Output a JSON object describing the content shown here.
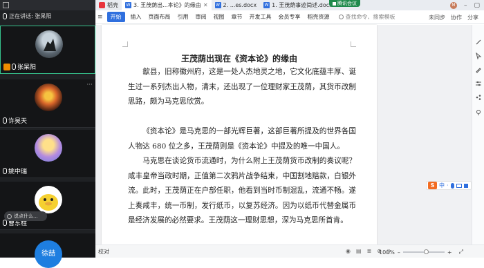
{
  "meeting": {
    "app_icon": "grid-icon",
    "speaking_label": "正在讲话: 张杲阳",
    "participants": [
      {
        "name": "张杲阳",
        "active": true
      },
      {
        "name": "许昊天",
        "active": false
      },
      {
        "name": "姚中瑞",
        "active": false
      },
      {
        "name": "曹东柱",
        "active": false
      },
      {
        "name": "徐喆",
        "active": false
      }
    ],
    "say_something": "说点什么..."
  },
  "browser": {
    "app_name": "稻壳",
    "tabs": [
      {
        "label": "3. 王茂荫出...本论》的缘由",
        "active": true
      },
      {
        "label": "2. ...es.docx",
        "active": false
      },
      {
        "label": "1. 王茂荫事迹简述.docx",
        "active": false
      }
    ],
    "share_badge": "腾讯会议",
    "avatar_letter": "M"
  },
  "ribbon": {
    "tabs": [
      "开始",
      "插入",
      "页面布局",
      "引用",
      "审阅",
      "视图",
      "章节",
      "开发工具",
      "会员专享",
      "稻壳资源"
    ],
    "search_placeholder": "查找命令、搜索模板",
    "right_items": [
      "未同步",
      "协作",
      "分享"
    ]
  },
  "document": {
    "title": "王茂荫出现在《资本论》的缘由",
    "paragraphs": [
      "歙县，旧称徽州府，这是一处人杰地灵之地，它文化底蕴丰厚、诞生过一系列杰出人物，清末，还出现了一位理财家王茂荫，其货币改制思路，颇为马克思欣赏。",
      "《资本论》是马克思的一部光辉巨著，这部巨著所提及的世界各国人物达 680 位之多，王茂荫则是《资本论》中提及的唯一中国人。",
      "马克思在谈论货币流通时，为什么附上王茂荫货币改制的奏议呢？咸丰皇帝当政时期，正值第二次鸦片战争结束，中国割地赔款，白银外流。此时，王茂荫正在户部任职，他看到当时币制混乱，流通不畅。遂上奏咸丰，统一币制，发行纸币，以复苏经济。因为以纸币代替金属币是经济发展的必然要求。王茂荫这一理财思想，深为马克思所首肯。"
    ]
  },
  "statusbar": {
    "left_text": "校对",
    "zoom": "100%"
  },
  "ime": {
    "logo": "S",
    "mode": "中"
  }
}
